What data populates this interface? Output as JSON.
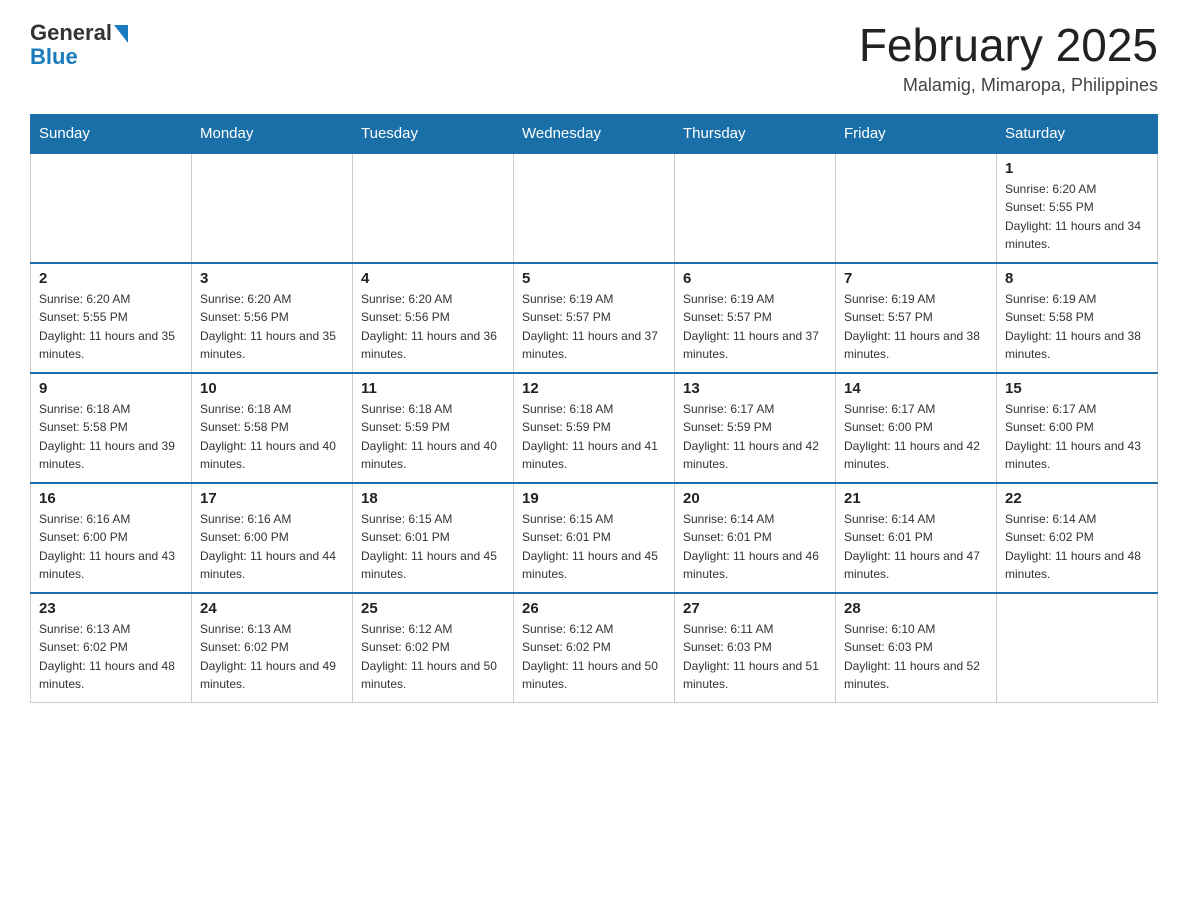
{
  "header": {
    "logo_general": "General",
    "logo_blue": "Blue",
    "month_title": "February 2025",
    "location": "Malamig, Mimaropa, Philippines"
  },
  "days_of_week": [
    "Sunday",
    "Monday",
    "Tuesday",
    "Wednesday",
    "Thursday",
    "Friday",
    "Saturday"
  ],
  "weeks": [
    [
      {
        "day": "",
        "sunrise": "",
        "sunset": "",
        "daylight": ""
      },
      {
        "day": "",
        "sunrise": "",
        "sunset": "",
        "daylight": ""
      },
      {
        "day": "",
        "sunrise": "",
        "sunset": "",
        "daylight": ""
      },
      {
        "day": "",
        "sunrise": "",
        "sunset": "",
        "daylight": ""
      },
      {
        "day": "",
        "sunrise": "",
        "sunset": "",
        "daylight": ""
      },
      {
        "day": "",
        "sunrise": "",
        "sunset": "",
        "daylight": ""
      },
      {
        "day": "1",
        "sunrise": "Sunrise: 6:20 AM",
        "sunset": "Sunset: 5:55 PM",
        "daylight": "Daylight: 11 hours and 34 minutes."
      }
    ],
    [
      {
        "day": "2",
        "sunrise": "Sunrise: 6:20 AM",
        "sunset": "Sunset: 5:55 PM",
        "daylight": "Daylight: 11 hours and 35 minutes."
      },
      {
        "day": "3",
        "sunrise": "Sunrise: 6:20 AM",
        "sunset": "Sunset: 5:56 PM",
        "daylight": "Daylight: 11 hours and 35 minutes."
      },
      {
        "day": "4",
        "sunrise": "Sunrise: 6:20 AM",
        "sunset": "Sunset: 5:56 PM",
        "daylight": "Daylight: 11 hours and 36 minutes."
      },
      {
        "day": "5",
        "sunrise": "Sunrise: 6:19 AM",
        "sunset": "Sunset: 5:57 PM",
        "daylight": "Daylight: 11 hours and 37 minutes."
      },
      {
        "day": "6",
        "sunrise": "Sunrise: 6:19 AM",
        "sunset": "Sunset: 5:57 PM",
        "daylight": "Daylight: 11 hours and 37 minutes."
      },
      {
        "day": "7",
        "sunrise": "Sunrise: 6:19 AM",
        "sunset": "Sunset: 5:57 PM",
        "daylight": "Daylight: 11 hours and 38 minutes."
      },
      {
        "day": "8",
        "sunrise": "Sunrise: 6:19 AM",
        "sunset": "Sunset: 5:58 PM",
        "daylight": "Daylight: 11 hours and 38 minutes."
      }
    ],
    [
      {
        "day": "9",
        "sunrise": "Sunrise: 6:18 AM",
        "sunset": "Sunset: 5:58 PM",
        "daylight": "Daylight: 11 hours and 39 minutes."
      },
      {
        "day": "10",
        "sunrise": "Sunrise: 6:18 AM",
        "sunset": "Sunset: 5:58 PM",
        "daylight": "Daylight: 11 hours and 40 minutes."
      },
      {
        "day": "11",
        "sunrise": "Sunrise: 6:18 AM",
        "sunset": "Sunset: 5:59 PM",
        "daylight": "Daylight: 11 hours and 40 minutes."
      },
      {
        "day": "12",
        "sunrise": "Sunrise: 6:18 AM",
        "sunset": "Sunset: 5:59 PM",
        "daylight": "Daylight: 11 hours and 41 minutes."
      },
      {
        "day": "13",
        "sunrise": "Sunrise: 6:17 AM",
        "sunset": "Sunset: 5:59 PM",
        "daylight": "Daylight: 11 hours and 42 minutes."
      },
      {
        "day": "14",
        "sunrise": "Sunrise: 6:17 AM",
        "sunset": "Sunset: 6:00 PM",
        "daylight": "Daylight: 11 hours and 42 minutes."
      },
      {
        "day": "15",
        "sunrise": "Sunrise: 6:17 AM",
        "sunset": "Sunset: 6:00 PM",
        "daylight": "Daylight: 11 hours and 43 minutes."
      }
    ],
    [
      {
        "day": "16",
        "sunrise": "Sunrise: 6:16 AM",
        "sunset": "Sunset: 6:00 PM",
        "daylight": "Daylight: 11 hours and 43 minutes."
      },
      {
        "day": "17",
        "sunrise": "Sunrise: 6:16 AM",
        "sunset": "Sunset: 6:00 PM",
        "daylight": "Daylight: 11 hours and 44 minutes."
      },
      {
        "day": "18",
        "sunrise": "Sunrise: 6:15 AM",
        "sunset": "Sunset: 6:01 PM",
        "daylight": "Daylight: 11 hours and 45 minutes."
      },
      {
        "day": "19",
        "sunrise": "Sunrise: 6:15 AM",
        "sunset": "Sunset: 6:01 PM",
        "daylight": "Daylight: 11 hours and 45 minutes."
      },
      {
        "day": "20",
        "sunrise": "Sunrise: 6:14 AM",
        "sunset": "Sunset: 6:01 PM",
        "daylight": "Daylight: 11 hours and 46 minutes."
      },
      {
        "day": "21",
        "sunrise": "Sunrise: 6:14 AM",
        "sunset": "Sunset: 6:01 PM",
        "daylight": "Daylight: 11 hours and 47 minutes."
      },
      {
        "day": "22",
        "sunrise": "Sunrise: 6:14 AM",
        "sunset": "Sunset: 6:02 PM",
        "daylight": "Daylight: 11 hours and 48 minutes."
      }
    ],
    [
      {
        "day": "23",
        "sunrise": "Sunrise: 6:13 AM",
        "sunset": "Sunset: 6:02 PM",
        "daylight": "Daylight: 11 hours and 48 minutes."
      },
      {
        "day": "24",
        "sunrise": "Sunrise: 6:13 AM",
        "sunset": "Sunset: 6:02 PM",
        "daylight": "Daylight: 11 hours and 49 minutes."
      },
      {
        "day": "25",
        "sunrise": "Sunrise: 6:12 AM",
        "sunset": "Sunset: 6:02 PM",
        "daylight": "Daylight: 11 hours and 50 minutes."
      },
      {
        "day": "26",
        "sunrise": "Sunrise: 6:12 AM",
        "sunset": "Sunset: 6:02 PM",
        "daylight": "Daylight: 11 hours and 50 minutes."
      },
      {
        "day": "27",
        "sunrise": "Sunrise: 6:11 AM",
        "sunset": "Sunset: 6:03 PM",
        "daylight": "Daylight: 11 hours and 51 minutes."
      },
      {
        "day": "28",
        "sunrise": "Sunrise: 6:10 AM",
        "sunset": "Sunset: 6:03 PM",
        "daylight": "Daylight: 11 hours and 52 minutes."
      },
      {
        "day": "",
        "sunrise": "",
        "sunset": "",
        "daylight": ""
      }
    ]
  ]
}
